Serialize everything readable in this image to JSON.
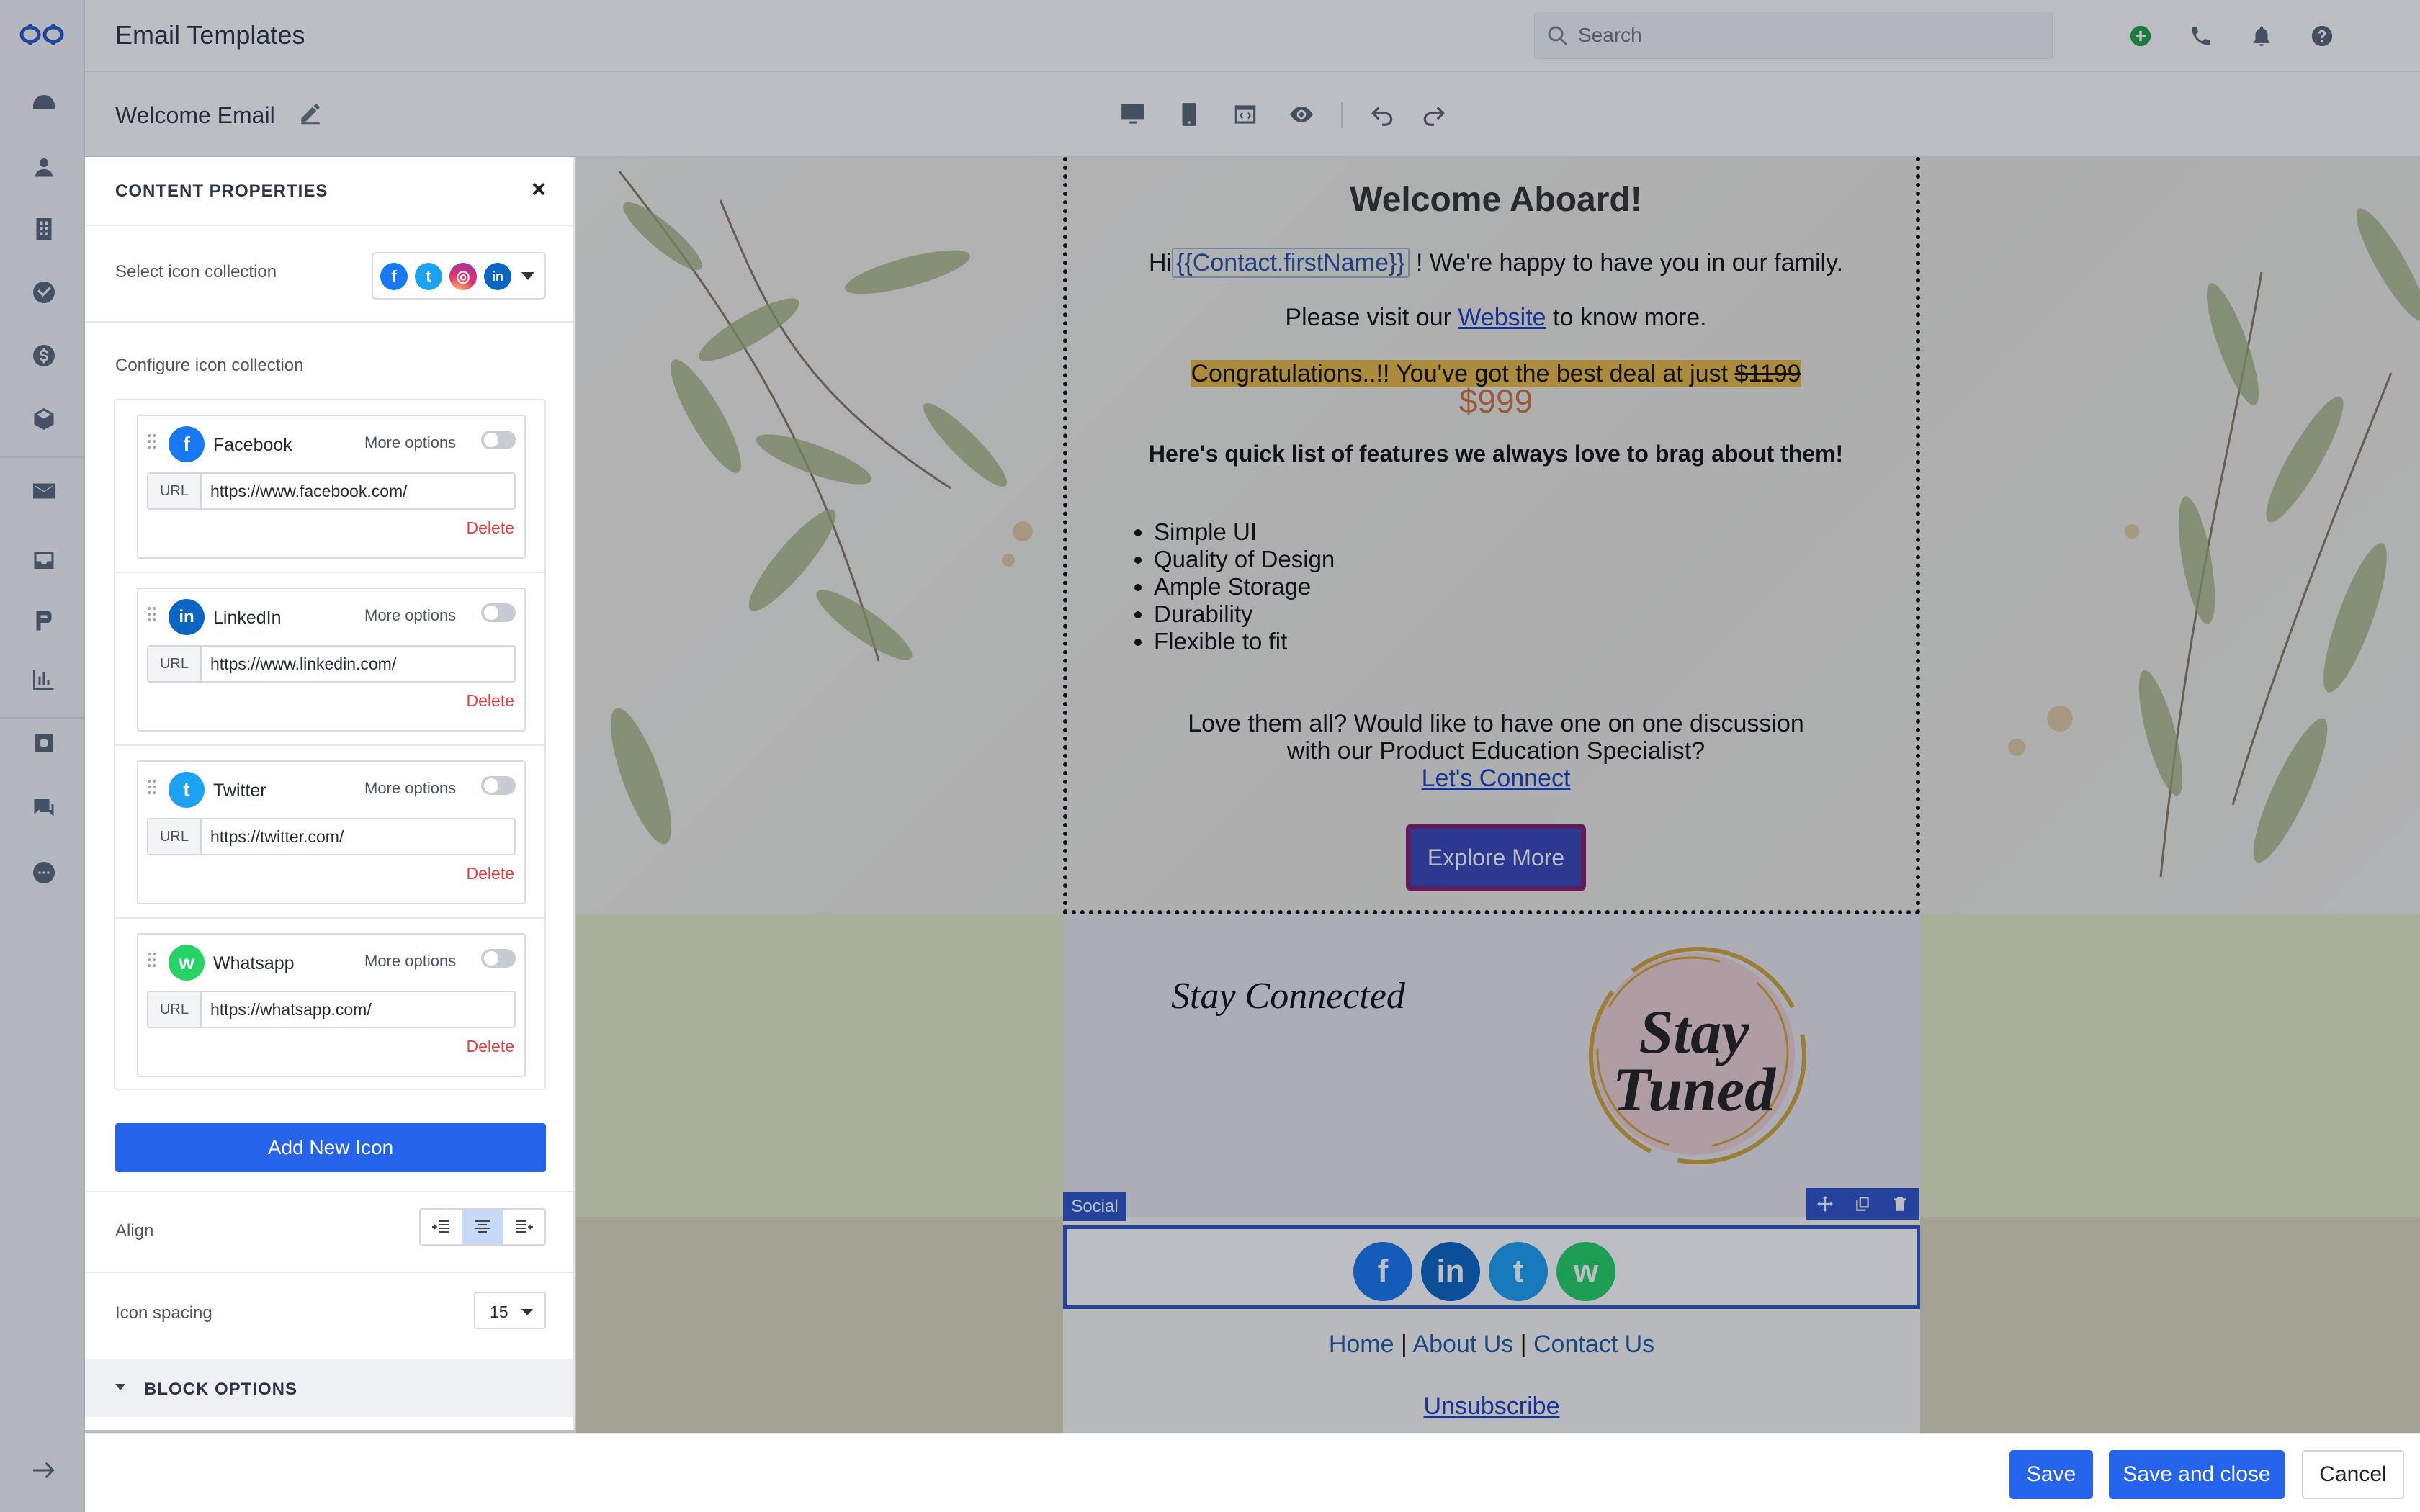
{
  "app": {
    "title": "Email Templates"
  },
  "search": {
    "placeholder": "Search"
  },
  "template": {
    "name": "Welcome Email"
  },
  "panel": {
    "title": "CONTENT PROPERTIES",
    "close": "×",
    "select_label": "Select icon collection",
    "configure_label": "Configure icon collection",
    "items": [
      {
        "name": "Facebook",
        "more": "More options",
        "url_tag": "URL",
        "url": "https://www.facebook.com/",
        "delete": "Delete",
        "color": "#1877f2",
        "glyph": "f",
        "icon": "facebook-icon"
      },
      {
        "name": "LinkedIn",
        "more": "More options",
        "url_tag": "URL",
        "url": "https://www.linkedin.com/",
        "delete": "Delete",
        "color": "#0a66c2",
        "glyph": "in",
        "icon": "linkedin-icon"
      },
      {
        "name": "Twitter",
        "more": "More options",
        "url_tag": "URL",
        "url": "https://twitter.com/",
        "delete": "Delete",
        "color": "#1da1f2",
        "glyph": "t",
        "icon": "twitter-icon"
      },
      {
        "name": "Whatsapp",
        "more": "More options",
        "url_tag": "URL",
        "url": "https://whatsapp.com/",
        "delete": "Delete",
        "color": "#25d366",
        "glyph": "w",
        "icon": "whatsapp-icon"
      }
    ],
    "add_button": "Add New Icon",
    "align_label": "Align",
    "spacing_label": "Icon spacing",
    "spacing_value": "15",
    "block_options": "BLOCK OPTIONS"
  },
  "email": {
    "title": "Welcome Aboard!",
    "greeting_pre": "Hi",
    "merge_tag": "{{Contact.firstName}}",
    "greeting_post": " ! We're happy to have you in our family.",
    "visit_pre": "Please visit our ",
    "visit_link": "Website",
    "visit_post": " to know more.",
    "deal_text": "Congratulations..!! You've got the best deal at just ",
    "old_price": "$1199",
    "new_price": "$999",
    "features_heading": "Here's quick list of features we always love to brag about them!",
    "features": [
      "Simple UI",
      "Quality of Design",
      "Ample Storage",
      "Durability",
      "Flexible to fit"
    ],
    "discuss_line1": "Love them all? Would like to have one on one discussion",
    "discuss_line2": "with our Product Education Specialist?",
    "connect_link": "Let's Connect",
    "explore_button": "Explore More",
    "stay_connected": "Stay Connected",
    "badge_line1": "Stay",
    "badge_line2": "Tuned",
    "social_tag": "Social",
    "footer": {
      "home": "Home",
      "sep1": " | ",
      "about": "About Us",
      "sep2": " | ",
      "contact": "Contact Us"
    },
    "unsubscribe": "Unsubscribe"
  },
  "actions": {
    "save": "Save",
    "save_close": "Save and close",
    "cancel": "Cancel"
  },
  "colors": {
    "primary": "#2563eb",
    "danger": "#e53e3e",
    "accent_price": "#d4713f"
  }
}
